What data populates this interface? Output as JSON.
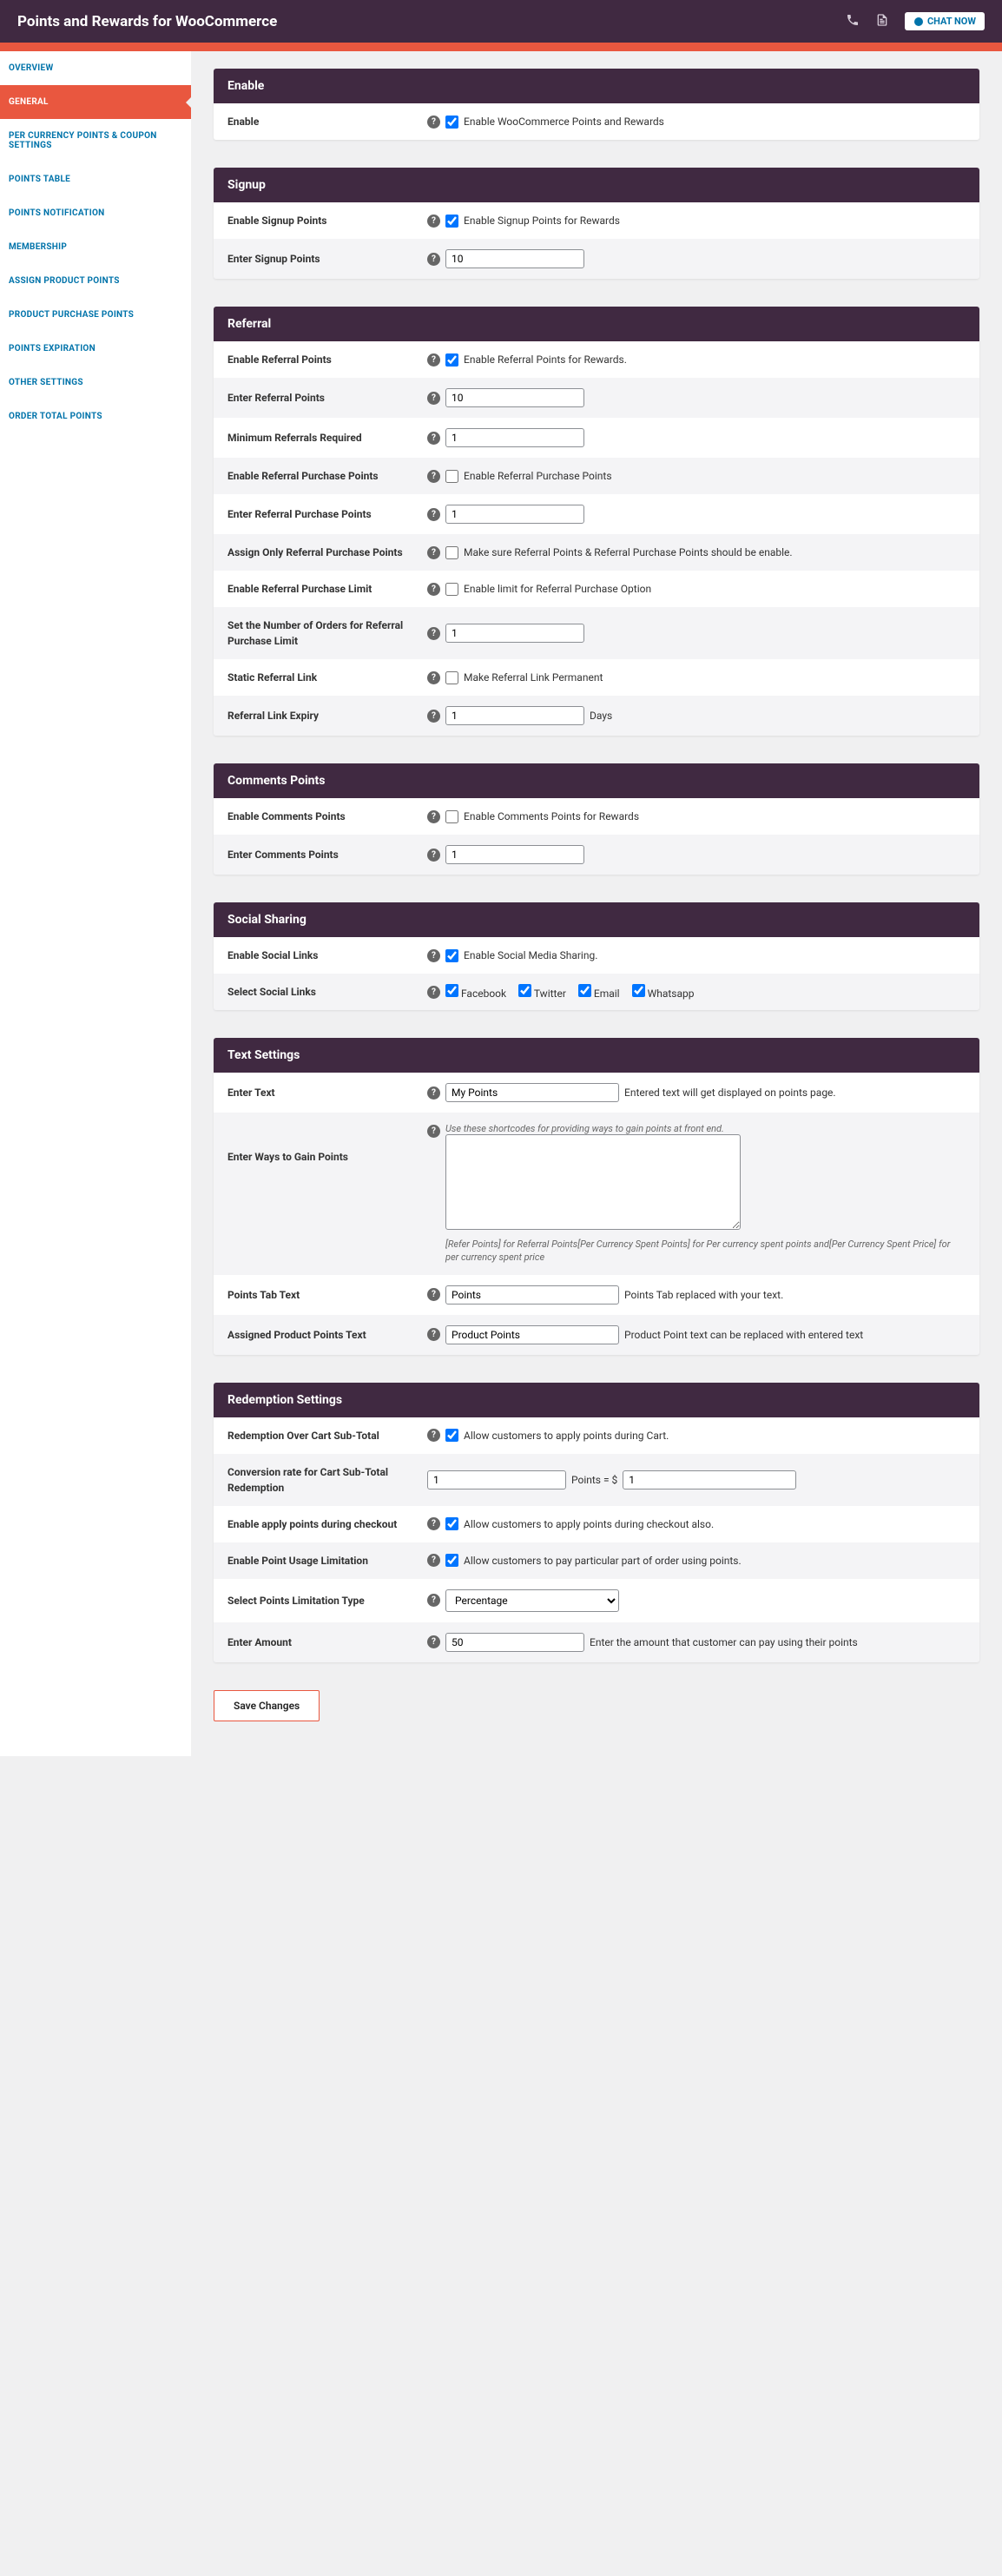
{
  "header": {
    "title": "Points and Rewards for WooCommerce",
    "chat": "CHAT NOW"
  },
  "nav": {
    "overview": "OVERVIEW",
    "general": "GENERAL",
    "percurrency": "PER CURRENCY POINTS & COUPON SETTINGS",
    "pointstable": "POINTS TABLE",
    "notification": "POINTS NOTIFICATION",
    "membership": "MEMBERSHIP",
    "assign": "ASSIGN PRODUCT POINTS",
    "purchase": "PRODUCT PURCHASE POINTS",
    "expiration": "POINTS EXPIRATION",
    "other": "OTHER SETTINGS",
    "ordertotal": "ORDER TOTAL POINTS"
  },
  "enable": {
    "head": "Enable",
    "label": "Enable",
    "text": "Enable WooCommerce Points and Rewards"
  },
  "signup": {
    "head": "Signup",
    "enable_label": "Enable Signup Points",
    "enable_text": "Enable Signup Points for Rewards",
    "enter_label": "Enter Signup Points",
    "enter_val": "10"
  },
  "referral": {
    "head": "Referral",
    "enable_label": "Enable Referral Points",
    "enable_text": "Enable Referral Points for Rewards.",
    "enter_label": "Enter Referral Points",
    "enter_val": "10",
    "min_label": "Minimum Referrals Required",
    "min_val": "1",
    "purchase_enable_label": "Enable Referral Purchase Points",
    "purchase_enable_text": "Enable Referral Purchase Points",
    "purchase_enter_label": "Enter Referral Purchase Points",
    "purchase_enter_val": "1",
    "assign_label": "Assign Only Referral Purchase Points",
    "assign_text": "Make sure Referral Points & Referral Purchase Points should be enable.",
    "limit_label": "Enable Referral Purchase Limit",
    "limit_text": "Enable limit for Referral Purchase Option",
    "orders_label": "Set the Number of Orders for Referral Purchase Limit",
    "orders_val": "1",
    "static_label": "Static Referral Link",
    "static_text": "Make Referral Link Permanent",
    "expiry_label": "Referral Link Expiry",
    "expiry_val": "1",
    "expiry_unit": "Days"
  },
  "comments": {
    "head": "Comments Points",
    "enable_label": "Enable Comments Points",
    "enable_text": "Enable Comments Points for Rewards",
    "enter_label": "Enter Comments Points",
    "enter_val": "1"
  },
  "social": {
    "head": "Social Sharing",
    "enable_label": "Enable Social Links",
    "enable_text": "Enable Social Media Sharing.",
    "select_label": "Select Social Links",
    "fb": "Facebook",
    "tw": "Twitter",
    "em": "Email",
    "wa": "Whatsapp"
  },
  "text": {
    "head": "Text Settings",
    "enter_label": "Enter Text",
    "enter_val": "My Points",
    "enter_hint": "Entered text will get displayed on points page.",
    "ways_label": "Enter Ways to Gain Points",
    "ways_hint_top": "Use these shortcodes for providing ways to gain points at front end.",
    "ways_hint_bottom": "[Refer Points] for Referral Points[Per Currency Spent Points] for Per currency spent points and[Per Currency Spent Price] for per currency spent price",
    "tab_label": "Points Tab Text",
    "tab_val": "Points",
    "tab_hint": "Points Tab replaced with your text.",
    "assigned_label": "Assigned Product Points Text",
    "assigned_val": "Product Points",
    "assigned_hint": "Product Point text can be replaced with entered text"
  },
  "redemption": {
    "head": "Redemption Settings",
    "over_label": "Redemption Over Cart Sub-Total",
    "over_text": "Allow customers to apply points during Cart.",
    "conv_label": "Conversion rate for Cart Sub-Total Redemption",
    "conv_pts": "1",
    "conv_mid": "Points = $",
    "conv_currency": "1",
    "checkout_label": "Enable apply points during checkout",
    "checkout_text": "Allow customers to apply points during checkout also.",
    "usage_label": "Enable Point Usage Limitation",
    "usage_text": "Allow customers to pay particular part of order using points.",
    "limit_type_label": "Select Points Limitation Type",
    "limit_type_val": "Percentage",
    "amount_label": "Enter Amount",
    "amount_val": "50",
    "amount_hint": "Enter the amount that customer can pay using their points"
  },
  "save": "Save Changes"
}
